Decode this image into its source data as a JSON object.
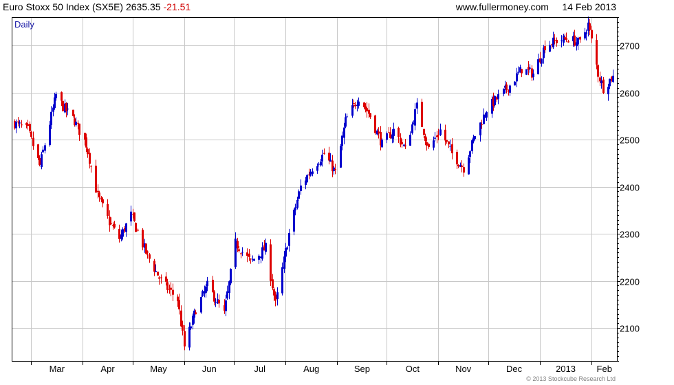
{
  "header": {
    "instrument": "Euro Stoxx 50 Index (SX5E)",
    "last": "2635.35",
    "change": "-21.51",
    "site": "www.fullermoney.com",
    "date": "14 Feb 2013"
  },
  "footer": {
    "copyright": "© 2013 Stockcube Research Ltd"
  },
  "colors": {
    "up": "#0000cc",
    "down": "#dd0000",
    "grid": "#c8c8c8",
    "change": "#d00000",
    "period": "#1a1aa6"
  },
  "chart_data": {
    "type": "candlestick",
    "period_label": "Daily",
    "y_axis": {
      "position": "right",
      "ticks": [
        2100,
        2200,
        2300,
        2400,
        2500,
        2600,
        2700
      ],
      "ylim": [
        2030,
        2760
      ]
    },
    "x_axis": {
      "labels": [
        "Mar",
        "Apr",
        "May",
        "Jun",
        "Jul",
        "Aug",
        "Sep",
        "Oct",
        "Nov",
        "Dec",
        "2013",
        "Feb"
      ]
    },
    "grid": true,
    "series": {
      "start_date": "2012-02-20",
      "end_date": "2013-02-14",
      "key_closes": [
        [
          "2012-02-20",
          2535
        ],
        [
          "2012-02-28",
          2520
        ],
        [
          "2012-03-06",
          2445
        ],
        [
          "2012-03-16",
          2595
        ],
        [
          "2012-03-20",
          2570
        ],
        [
          "2012-03-27",
          2540
        ],
        [
          "2012-04-03",
          2490
        ],
        [
          "2012-04-10",
          2380
        ],
        [
          "2012-04-17",
          2325
        ],
        [
          "2012-04-23",
          2290
        ],
        [
          "2012-04-30",
          2340
        ],
        [
          "2012-05-09",
          2260
        ],
        [
          "2012-05-18",
          2200
        ],
        [
          "2012-05-28",
          2160
        ],
        [
          "2012-06-01",
          2060
        ],
        [
          "2012-06-08",
          2140
        ],
        [
          "2012-06-15",
          2190
        ],
        [
          "2012-06-25",
          2130
        ],
        [
          "2012-07-02",
          2280
        ],
        [
          "2012-07-11",
          2240
        ],
        [
          "2012-07-20",
          2270
        ],
        [
          "2012-07-26",
          2150
        ],
        [
          "2012-08-03",
          2300
        ],
        [
          "2012-08-10",
          2400
        ],
        [
          "2012-08-17",
          2440
        ],
        [
          "2012-08-24",
          2470
        ],
        [
          "2012-08-31",
          2430
        ],
        [
          "2012-09-06",
          2540
        ],
        [
          "2012-09-14",
          2590
        ],
        [
          "2012-09-21",
          2550
        ],
        [
          "2012-09-28",
          2490
        ],
        [
          "2012-10-05",
          2520
        ],
        [
          "2012-10-12",
          2480
        ],
        [
          "2012-10-19",
          2570
        ],
        [
          "2012-10-26",
          2480
        ],
        [
          "2012-11-02",
          2520
        ],
        [
          "2012-11-09",
          2470
        ],
        [
          "2012-11-16",
          2440
        ],
        [
          "2012-11-23",
          2510
        ],
        [
          "2012-11-30",
          2565
        ],
        [
          "2012-12-07",
          2590
        ],
        [
          "2012-12-14",
          2615
        ],
        [
          "2012-12-21",
          2650
        ],
        [
          "2012-12-28",
          2640
        ],
        [
          "2013-01-04",
          2700
        ],
        [
          "2013-01-11",
          2710
        ],
        [
          "2013-01-18",
          2715
        ],
        [
          "2013-01-25",
          2705
        ],
        [
          "2013-01-30",
          2745
        ],
        [
          "2013-02-05",
          2640
        ],
        [
          "2013-02-08",
          2610
        ],
        [
          "2013-02-14",
          2635.35
        ]
      ]
    }
  }
}
